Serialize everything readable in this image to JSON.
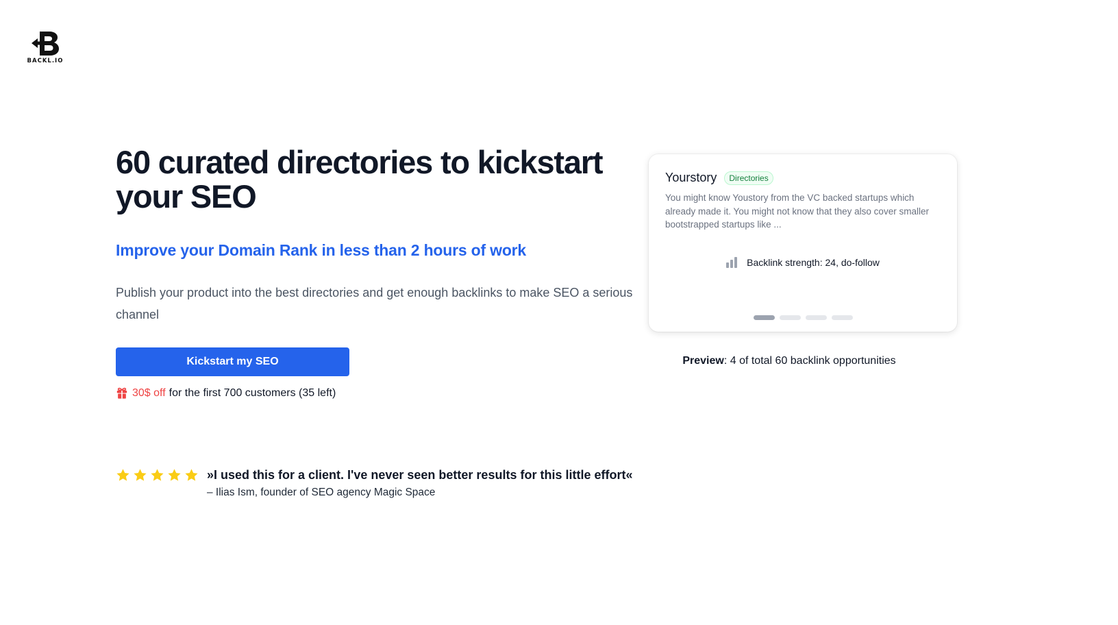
{
  "brand": {
    "logo_text": "BACKL.IO"
  },
  "hero": {
    "title": "60 curated directories to kickstart your SEO",
    "subtitle": "Improve your Domain Rank in less than 2 hours of work",
    "description": "Publish your product into the best directories and get enough backlinks to make SEO a serious channel"
  },
  "cta": {
    "label": "Kickstart my SEO"
  },
  "offer": {
    "icon": "gift-icon",
    "highlight": "30$ off",
    "text": "for the first 700 customers (35 left)",
    "color": "#ef4444"
  },
  "testimonial": {
    "rating": 5,
    "quote": "»I used this for a client. I've never seen better results for this little effort«",
    "author": "– Ilias Ism, founder of SEO agency Magic Space"
  },
  "card": {
    "title": "Yourstory",
    "badge": "Directories",
    "description": "You might know Youstory from the VC backed startups which already made it. You might not know that they also cover smaller bootstrapped startups like ...",
    "strength": "Backlink strength: 24, do-follow",
    "slides": 4,
    "active_slide": 1
  },
  "preview": {
    "label": "Preview",
    "text": ": 4 of total 60 backlink opportunities"
  },
  "colors": {
    "accent": "#2563eb",
    "star": "#facc15",
    "badge_text": "#15803d"
  }
}
